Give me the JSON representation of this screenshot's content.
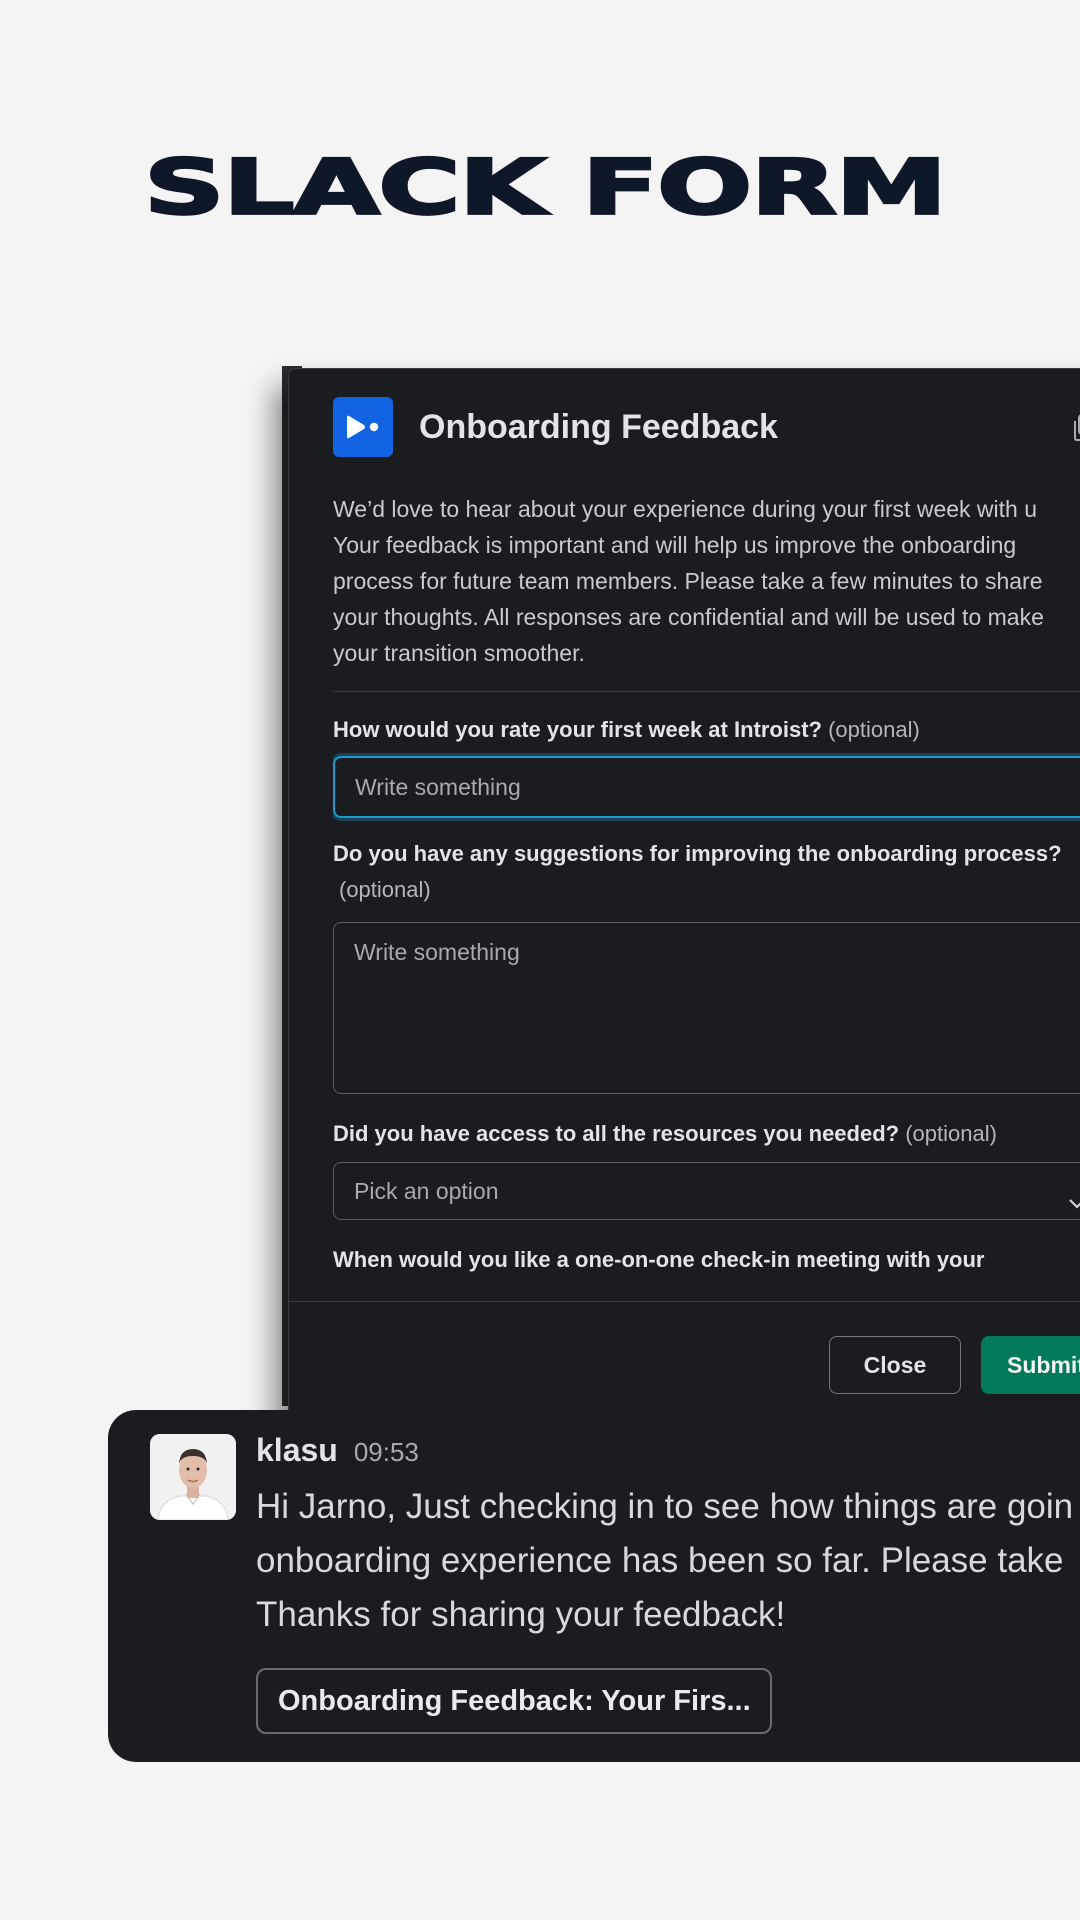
{
  "hero": {
    "title": "SLACK FORM"
  },
  "modal": {
    "title": "Onboarding Feedback",
    "app_icon": "app-logo-icon",
    "intro_text": "We’d love to hear about your experience during your first week with u\nYour feedback is important and will help us improve the onboarding\nprocess for future team members. Please take a few minutes to share\nyour thoughts. All responses are confidential and will be used to make\nyour transition smoother.",
    "questions": [
      {
        "label": "How would you rate your first week at Introist?",
        "optional": "(optional)",
        "placeholder": "Write something"
      },
      {
        "label": "Do you have any suggestions for improving the onboarding process?",
        "optional": "(optional)",
        "placeholder": "Write something"
      },
      {
        "label": "Did you have access to all the resources you needed?",
        "optional": "(optional)",
        "placeholder": "Pick an option"
      },
      {
        "label": "When would you like a one-on-one check-in meeting with your",
        "optional": ""
      }
    ],
    "buttons": {
      "close": "Close",
      "submit": "Submit"
    }
  },
  "message": {
    "sender": "klasu",
    "time": "09:53",
    "text": "Hi Jarno, Just checking in to see how things are goin\nonboarding experience has been so far. Please take\nThanks for sharing your feedback!",
    "attachment_label": "Onboarding Feedback: Your Firs..."
  },
  "colors": {
    "brand_blue": "#1163e1",
    "submit_green": "#007a5a",
    "focus_blue": "#1d9bd1",
    "modal_bg": "#1b1c20",
    "page_bg": "#f4f4f4",
    "headline": "#0f1829"
  }
}
